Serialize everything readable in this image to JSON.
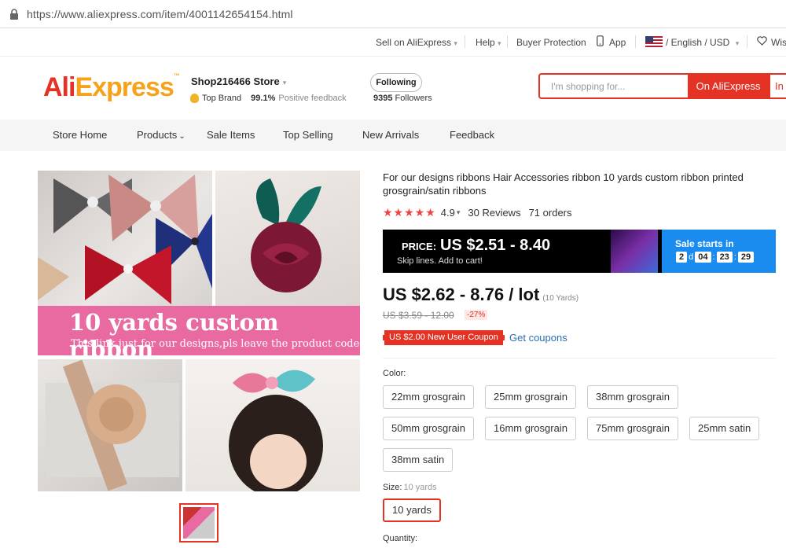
{
  "browser": {
    "url": "https://www.aliexpress.com/item/4001142654154.html"
  },
  "topbar": {
    "sell": "Sell on AliExpress",
    "help": "Help",
    "buyer_protection": "Buyer Protection",
    "app": "App",
    "lang": "/ English /",
    "currency": "USD",
    "wishlist": "Wis"
  },
  "header": {
    "logo_ali": "Ali",
    "logo_express": "Express",
    "store_name": "Shop216466 Store",
    "top_brand": "Top Brand",
    "positive_pct": "99.1%",
    "positive_label": "Positive feedback",
    "following_label": "Following",
    "followers_count": "9395",
    "followers_label": "Followers",
    "search_placeholder": "I'm shopping for...",
    "search_btn_1": "On AliExpress",
    "search_btn_2": "In"
  },
  "nav": {
    "items": [
      "Store Home",
      "Products",
      "Sale Items",
      "Top Selling",
      "New Arrivals",
      "Feedback"
    ]
  },
  "gallery": {
    "banner_title": "10 yards custom ribbon",
    "banner_sub": "This link just for our designs,pls leave the product code"
  },
  "product": {
    "title": "For our designs ribbons Hair Accessories ribbon 10 yards custom ribbon printed grosgrain/satin ribbons",
    "rating": "4.9",
    "reviews": "30 Reviews",
    "orders": "71 orders",
    "rating_value": 4.9
  },
  "promo": {
    "price_label": "PRICE:",
    "price_value": "US $2.51 - 8.40",
    "sub": "Skip lines. Add to cart!",
    "sale_starts": "Sale starts in",
    "days": "2",
    "d": "d",
    "hours": "04",
    "minutes": "23",
    "seconds": "29"
  },
  "pricing": {
    "price": "US $2.62 - 8.76 / lot",
    "unit": "(10 Yards)",
    "old_price": "US $3.59 - 12.00",
    "discount": "-27%",
    "coupon": "US $2.00 New User Coupon",
    "get_coupons": "Get coupons"
  },
  "options": {
    "color_label": "Color:",
    "colors": [
      "22mm grosgrain",
      "25mm grosgrain",
      "38mm grosgrain",
      "50mm grosgrain",
      "16mm grosgrain",
      "75mm grosgrain",
      "25mm satin",
      "38mm satin"
    ],
    "size_label": "Size:",
    "size_value": "10 yards",
    "sizes": [
      "10 yards"
    ],
    "quantity_label": "Quantity:"
  },
  "colors": {
    "accent": "#e43225",
    "brand_orange": "#f7a21b",
    "promo_blue": "#1a8cf0"
  }
}
